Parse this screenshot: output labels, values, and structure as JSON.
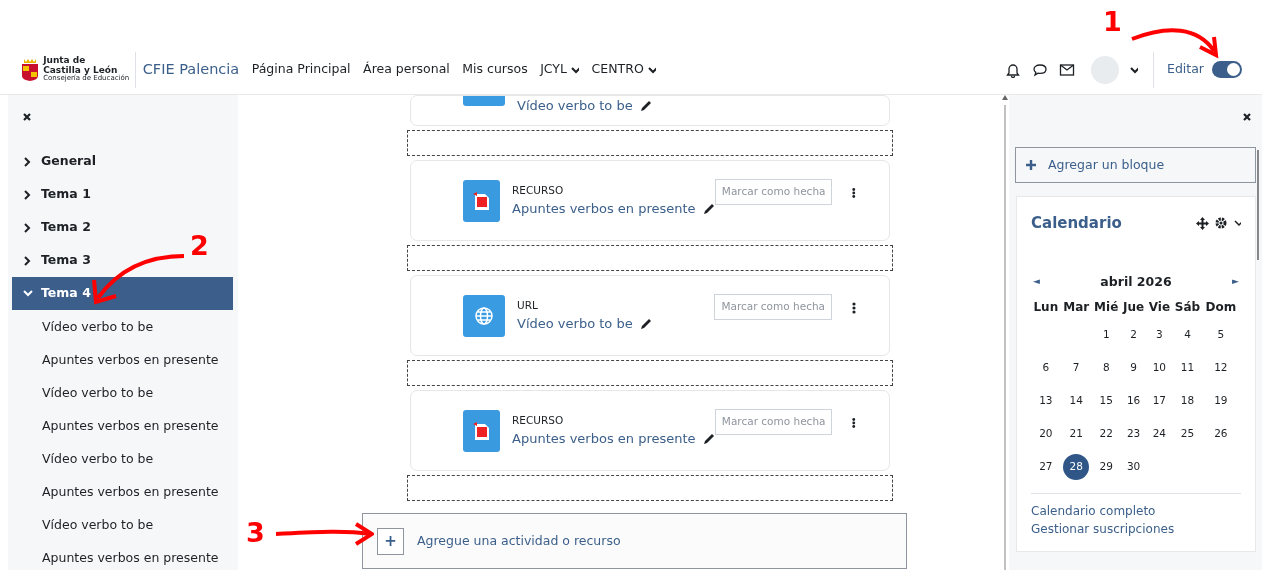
{
  "navbar": {
    "logo": {
      "line1": "Junta de",
      "line2": "Castilla y León",
      "line3": "Consejería de Educación"
    },
    "site_name": "CFIE Palencia",
    "links": [
      {
        "label": "Página Principal",
        "dropdown": false
      },
      {
        "label": "Área personal",
        "dropdown": false
      },
      {
        "label": "Mis cursos",
        "dropdown": false
      },
      {
        "label": "JCYL",
        "dropdown": true
      },
      {
        "label": "CENTRO",
        "dropdown": true
      }
    ],
    "edit_label": "Editar",
    "edit_mode": {
      "on": true
    }
  },
  "course_index": {
    "items": [
      {
        "label": "General",
        "expanded": false,
        "selected": false
      },
      {
        "label": "Tema 1",
        "expanded": false,
        "selected": false
      },
      {
        "label": "Tema 2",
        "expanded": false,
        "selected": false
      },
      {
        "label": "Tema 3",
        "expanded": false,
        "selected": false
      },
      {
        "label": "Tema 4",
        "expanded": true,
        "selected": true,
        "children": [
          {
            "label": "Vídeo verbo to be"
          },
          {
            "label": "Apuntes verbos en presente"
          },
          {
            "label": "Vídeo verbo to be"
          },
          {
            "label": "Apuntes verbos en presente"
          },
          {
            "label": "Vídeo verbo to be"
          },
          {
            "label": "Apuntes verbos en presente"
          },
          {
            "label": "Vídeo verbo to be"
          },
          {
            "label": "Apuntes verbos en presente"
          }
        ]
      }
    ]
  },
  "activities": [
    {
      "kind": "url",
      "name": "Vídeo verbo to be",
      "partial": true
    },
    {
      "kind": "pdf",
      "type_label": "RECURSO",
      "name": "Apuntes verbos en presente",
      "completion_button": {
        "label": "Marcar como hecha",
        "disabled": true
      }
    },
    {
      "kind": "url",
      "type_label": "URL",
      "name": "Vídeo verbo to be",
      "completion_button": {
        "label": "Marcar como hecha",
        "disabled": true
      }
    },
    {
      "kind": "pdf",
      "type_label": "RECURSO",
      "name": "Apuntes verbos en presente",
      "completion_button": {
        "label": "Marcar como hecha",
        "disabled": true
      }
    }
  ],
  "add_activity": {
    "icon_text": "+",
    "label": "Agregue una actividad o recurso"
  },
  "blocks": {
    "add_block": "Agregar un bloque",
    "calendar": {
      "title": "Calendario",
      "prev": "◄",
      "month": "abril 2026",
      "next": "►",
      "weekdays": [
        "Lun",
        "Mar",
        "Mié",
        "Jue",
        "Vie",
        "Sáb",
        "Dom"
      ],
      "weeks": [
        [
          {
            "day": "1",
            "today": false
          },
          {
            "day": "2",
            "today": false
          },
          {
            "day": "3",
            "today": false
          },
          {
            "day": "4",
            "today": false
          },
          {
            "day": "5",
            "today": false
          }
        ],
        [
          {
            "day": "6",
            "today": false
          },
          {
            "day": "7",
            "today": false
          },
          {
            "day": "8",
            "today": false
          },
          {
            "day": "9",
            "today": false
          },
          {
            "day": "10",
            "today": false
          },
          {
            "day": "11",
            "today": false
          },
          {
            "day": "12",
            "today": false
          }
        ],
        [
          {
            "day": "13",
            "today": false
          },
          {
            "day": "14",
            "today": false
          },
          {
            "day": "15",
            "today": false
          },
          {
            "day": "16",
            "today": false
          },
          {
            "day": "17",
            "today": false
          },
          {
            "day": "18",
            "today": false
          },
          {
            "day": "19",
            "today": false
          }
        ],
        [
          {
            "day": "20",
            "today": false
          },
          {
            "day": "21",
            "today": false
          },
          {
            "day": "22",
            "today": false
          },
          {
            "day": "23",
            "today": false
          },
          {
            "day": "24",
            "today": false
          },
          {
            "day": "25",
            "today": false
          },
          {
            "day": "26",
            "today": false
          }
        ],
        [
          {
            "day": "27",
            "today": false
          },
          {
            "day": "28",
            "today": true
          },
          {
            "day": "29",
            "today": false
          },
          {
            "day": "30",
            "today": false
          }
        ]
      ],
      "links": [
        "Calendario completo",
        "Gestionar suscripciones"
      ]
    }
  },
  "annotations": [
    {
      "label": "1"
    },
    {
      "label": "2"
    },
    {
      "label": "3"
    }
  ]
}
